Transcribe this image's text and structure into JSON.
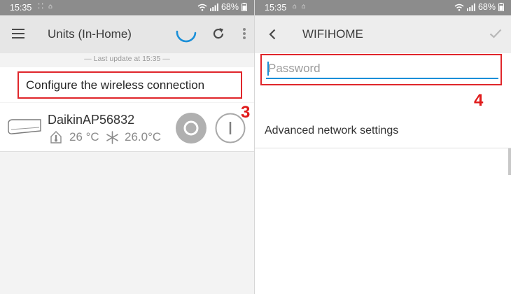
{
  "left": {
    "status": {
      "time": "15:35",
      "icons": "⁚⁚ ⌂",
      "battery": "68%"
    },
    "header": {
      "title": "Units (In-Home)",
      "menu_icon": "menu-icon",
      "refresh_icon": "refresh-icon",
      "more_icon": "more-vert-icon"
    },
    "last_update": "— Last update at 15:35 —",
    "configure_label": "Configure the wireless connection",
    "step": "3",
    "unit": {
      "name": "DaikinAP56832",
      "room_temp": "26 °C",
      "set_temp": "26.0°C",
      "power_off_icon": "power-off-icon",
      "power_on_icon": "power-on-icon"
    }
  },
  "right": {
    "status": {
      "time": "15:35",
      "icons": "⌂ ⌂",
      "battery": "68%"
    },
    "header": {
      "title": "WIFIHOME",
      "back_icon": "back-arrow-icon",
      "confirm_icon": "check-icon"
    },
    "password": {
      "placeholder": "Password",
      "value": ""
    },
    "step": "4",
    "advanced_label": "Advanced network settings"
  },
  "colors": {
    "accent": "#1a8fd8",
    "highlight": "#e0262b",
    "statusbar": "#8c8c8c",
    "appbar": "#e6e6e6"
  }
}
